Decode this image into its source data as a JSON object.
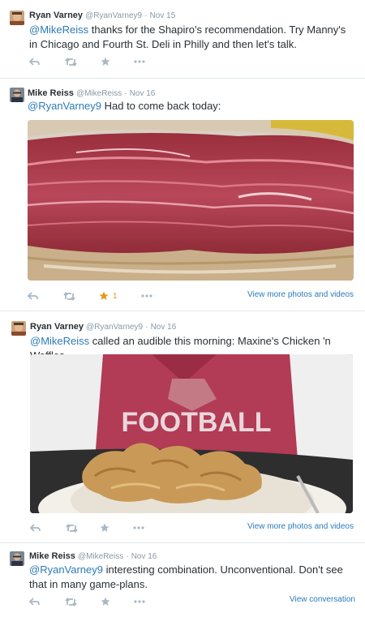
{
  "tweets": [
    {
      "name": "Ryan Varney",
      "handle": "@RyanVarney9",
      "dot": "·",
      "time": "Nov 15",
      "mention": "@MikeReiss",
      "text": " thanks for the Shapiro's recommendation. Try Manny's in Chicago and Fourth St. Deli in Philly and then let's talk."
    },
    {
      "name": "Mike Reiss",
      "handle": "@MikeReiss",
      "dot": "·",
      "time": "Nov 16",
      "mention": "@RyanVarney9",
      "text": " Had to come back today:",
      "favorite_count": "1",
      "more_link": "View more photos and videos",
      "photo": "corned-beef-sandwich"
    },
    {
      "name": "Ryan Varney",
      "handle": "@RyanVarney9",
      "dot": "·",
      "time": "Nov 16",
      "mention": "@MikeReiss",
      "text": " called an audible this morning: Maxine's Chicken 'n Waffles.",
      "more_link": "View more photos and videos",
      "photo": "fried-chicken-plate",
      "photo_shirt_text": "FOOTBALL"
    },
    {
      "name": "Mike Reiss",
      "handle": "@MikeReiss",
      "dot": "·",
      "time": "Nov 16",
      "mention": "@RyanVarney9",
      "text": " interesting combination. Unconventional. Don't see that in many game-plans.",
      "more_link": "View conversation"
    }
  ],
  "icons": [
    "reply-icon",
    "retweet-icon",
    "favorite-icon",
    "more-icon"
  ],
  "colors": {
    "link": "#2b7bb9",
    "name": "#292f33",
    "meta": "#8899a6",
    "favorited": "#e8961a",
    "divider": "#e1e8ed"
  }
}
